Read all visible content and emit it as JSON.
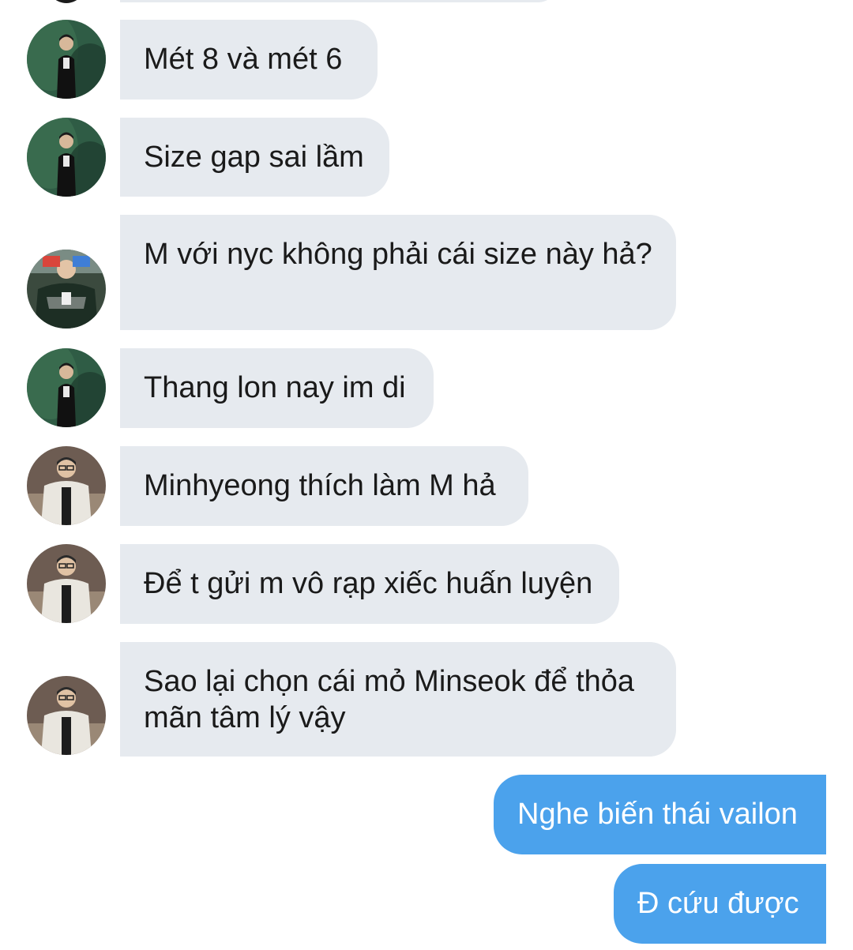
{
  "messages": [
    {
      "side": "incoming",
      "avatar": "green-suit",
      "text": "Mét 8 và mét 6"
    },
    {
      "side": "incoming",
      "avatar": "green-suit",
      "text": "Size gap sai lầm"
    },
    {
      "side": "incoming",
      "avatar": "jersey-group",
      "text": "M với nyc không phải cái size này hả?"
    },
    {
      "side": "incoming",
      "avatar": "green-suit",
      "text": "Thang lon nay im di"
    },
    {
      "side": "incoming",
      "avatar": "white-coat",
      "text": "Minhyeong thích làm M hả"
    },
    {
      "side": "incoming",
      "avatar": "white-coat",
      "text": "Để t gửi m vô rạp xiếc huấn luyện"
    },
    {
      "side": "incoming",
      "avatar": "white-coat",
      "text": "Sao lại chọn cái mỏ Minseok để thỏa mãn tâm lý vậy"
    },
    {
      "side": "outgoing",
      "text": "Nghe biến thái vailon"
    },
    {
      "side": "outgoing",
      "text": "Đ cứu được"
    }
  ],
  "colors": {
    "incoming_bubble": "#e6eaef",
    "outgoing_bubble": "#4ba2ec",
    "incoming_text": "#1a1a1a",
    "outgoing_text": "#ffffff"
  }
}
